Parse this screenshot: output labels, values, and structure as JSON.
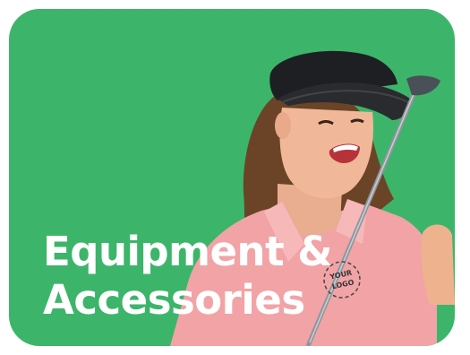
{
  "banner": {
    "title_line1": "Equipment &",
    "title_line2": "Accessories",
    "logo_text": "YOUR LOGO",
    "image": "golfer-woman-pink-polo-visor-holding-golf-club",
    "colors": {
      "background": "#3cb56a",
      "title": "#ffffff",
      "shirt": "#f2a3a6",
      "visor": "#1e1f22"
    }
  }
}
